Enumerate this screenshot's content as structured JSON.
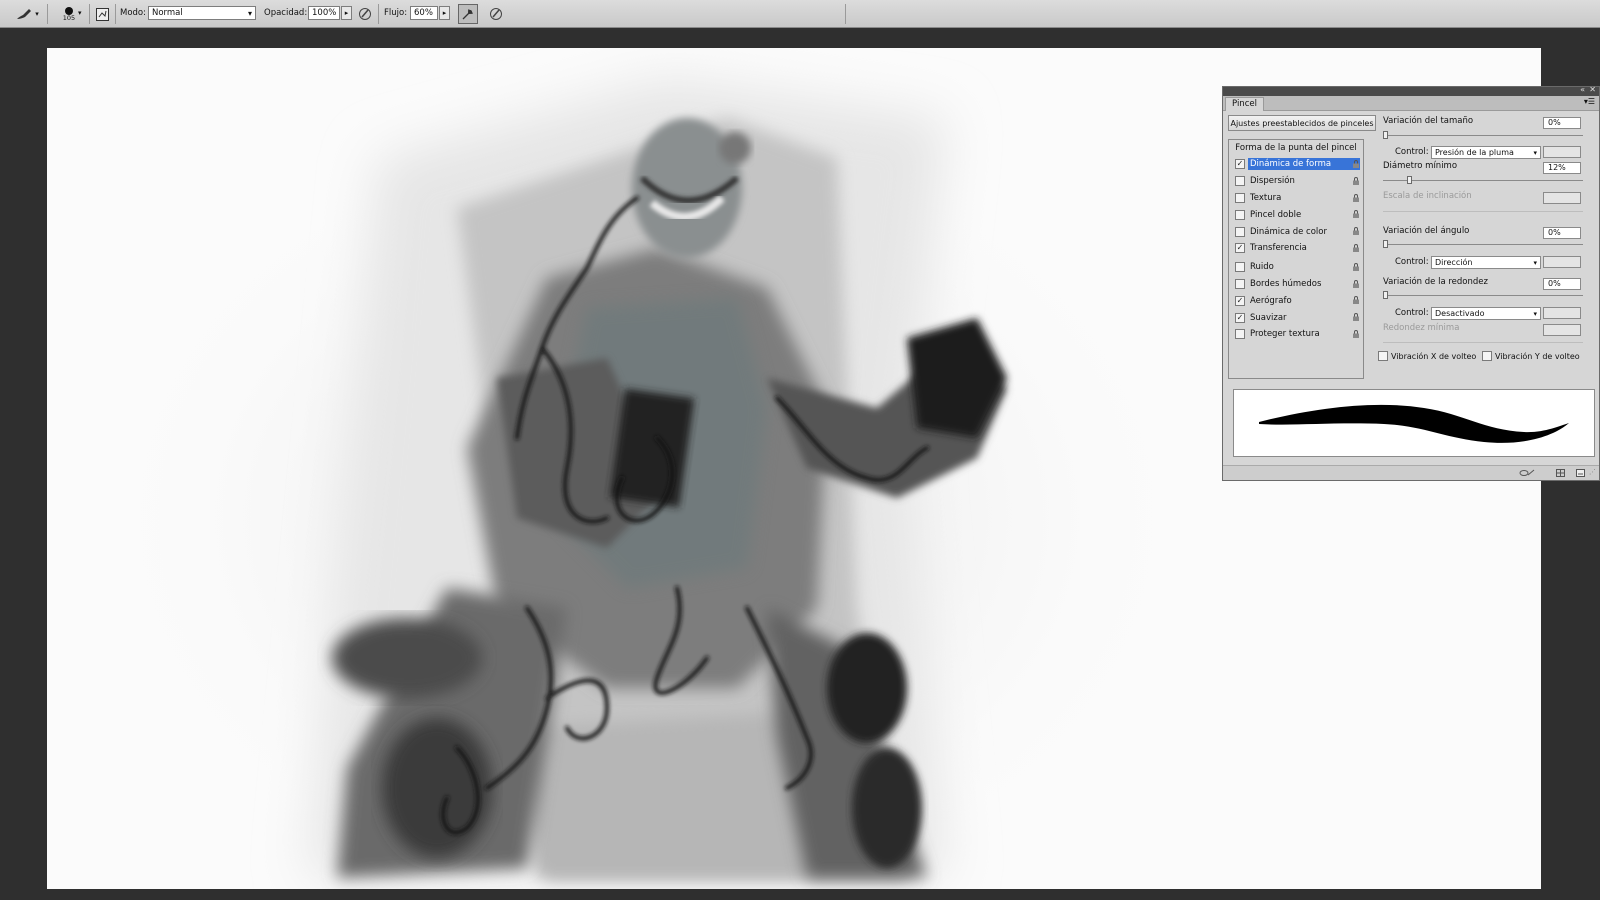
{
  "options_bar": {
    "tool_icon": "brush-icon",
    "brush_size": "105",
    "mode_label": "Modo:",
    "mode_value": "Normal",
    "opacity_label": "Opacidad:",
    "opacity_value": "100%",
    "flow_label": "Flujo:",
    "flow_value": "60%",
    "pressure_opacity_icon": "pen-pressure-icon",
    "airbrush_icon": "airbrush-icon",
    "pressure_size_icon": "pen-pressure-size-icon"
  },
  "canvas": {
    "description_icon": "painting-canvas"
  },
  "brush_panel": {
    "tab_label": "Pincel",
    "presets_button": "Ajustes preestablecidos de pinceles",
    "categories_title": "Forma de la punta del pincel",
    "categories": [
      {
        "label": "Dinámica de forma",
        "checked": true,
        "selected": true
      },
      {
        "label": "Dispersión",
        "checked": false,
        "selected": false
      },
      {
        "label": "Textura",
        "checked": false,
        "selected": false
      },
      {
        "label": "Pincel doble",
        "checked": false,
        "selected": false
      },
      {
        "label": "Dinámica de color",
        "checked": false,
        "selected": false
      },
      {
        "label": "Transferencia",
        "checked": true,
        "selected": false
      },
      {
        "label": "Ruido",
        "checked": false,
        "selected": false
      },
      {
        "label": "Bordes húmedos",
        "checked": false,
        "selected": false
      },
      {
        "label": "Aerógrafo",
        "checked": true,
        "selected": false
      },
      {
        "label": "Suavizar",
        "checked": true,
        "selected": false
      },
      {
        "label": "Proteger textura",
        "checked": false,
        "selected": false
      }
    ],
    "size_jitter_label": "Variación del tamaño",
    "size_jitter_value": "0%",
    "control_label": "Control:",
    "size_control_value": "Presión de la pluma",
    "min_diameter_label": "Diámetro mínimo",
    "min_diameter_value": "12%",
    "tilt_scale_label": "Escala de inclinación",
    "angle_jitter_label": "Variación del ángulo",
    "angle_jitter_value": "0%",
    "angle_control_value": "Dirección",
    "roundness_jitter_label": "Variación de la redondez",
    "roundness_jitter_value": "0%",
    "roundness_control_value": "Desactivado",
    "min_roundness_label": "Redondez mínima",
    "flip_x_label": "Vibración X de volteo",
    "flip_y_label": "Vibración Y de volteo",
    "flip_x_checked": false,
    "flip_y_checked": false
  }
}
